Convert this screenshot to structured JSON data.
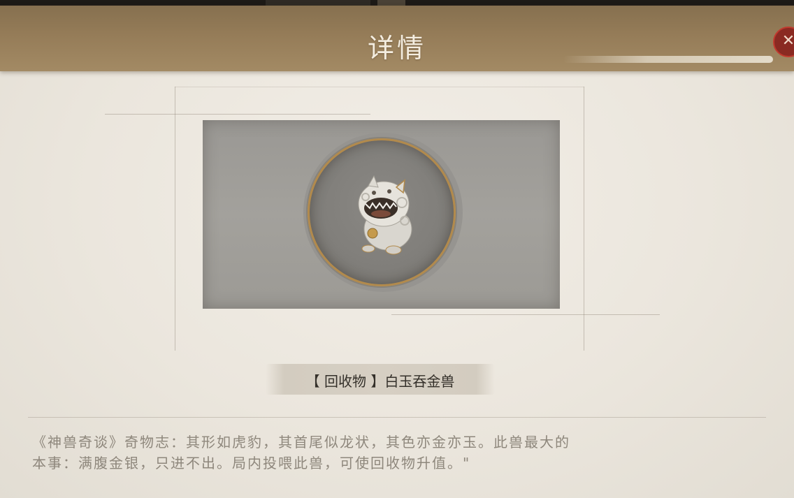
{
  "header": {
    "title": "详情",
    "close_icon": "close-icon"
  },
  "item": {
    "tag": "【 回收物 】",
    "name": "白玉吞金兽",
    "image_icon": "white-jade-beast-icon",
    "frame_accent": "#b28a4c"
  },
  "description": {
    "line1": "《神兽奇谈》奇物志：其形如虎豹，其首尾似龙状，其色亦金亦玉。此兽最大的",
    "line2": "本事：满腹金银，只进不出。局内投喂此兽，可使回收物升值。\""
  },
  "colors": {
    "header_bar": "#957c58",
    "paper": "#ebe6dd",
    "image_panel": "#a3a19c",
    "text_dark": "#34302a",
    "text_muted": "#8e877c"
  }
}
